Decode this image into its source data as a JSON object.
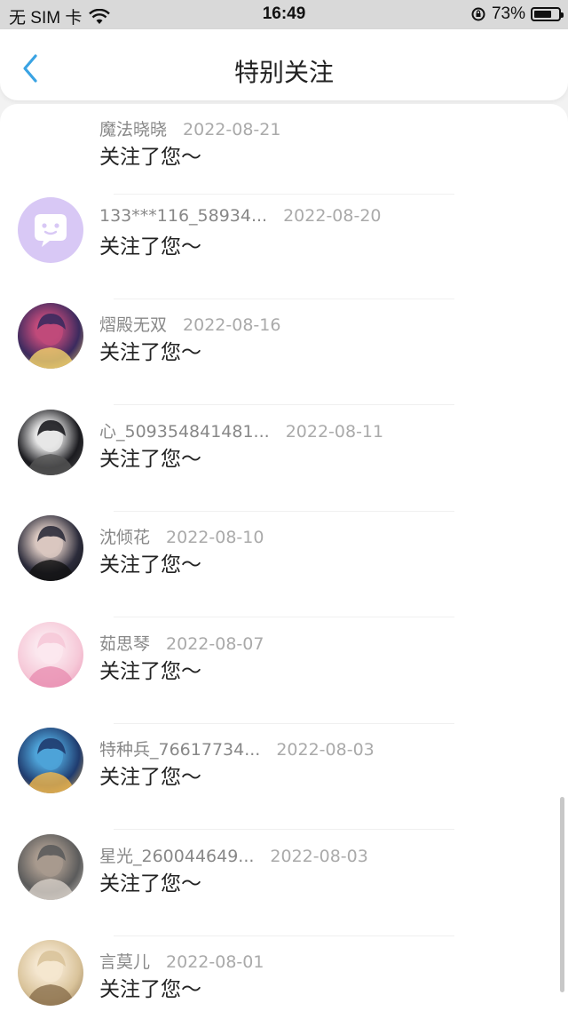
{
  "status_bar": {
    "carrier": "无 SIM 卡",
    "time": "16:49",
    "battery_pct": "73%",
    "battery_level": 0.73
  },
  "nav": {
    "title": "特别关注"
  },
  "colors": {
    "accent": "#3aa3e3",
    "bubble_avatar_bg": "#d8c8f5"
  },
  "items": [
    {
      "name": "魔法晓晓",
      "date": "2022-08-21",
      "message": "关注了您～",
      "avatar": "none"
    },
    {
      "name": "133***116_58934...",
      "date": "2022-08-20",
      "message": "关注了您～",
      "avatar": "chat-bubble"
    },
    {
      "name": "熠殿无双",
      "date": "2022-08-16",
      "message": "关注了您～",
      "avatar": "anime"
    },
    {
      "name": "心_509354841481...",
      "date": "2022-08-11",
      "message": "关注了您～",
      "avatar": "anime"
    },
    {
      "name": "沈倾花",
      "date": "2022-08-10",
      "message": "关注了您～",
      "avatar": "anime"
    },
    {
      "name": "茹思琴",
      "date": "2022-08-07",
      "message": "关注了您～",
      "avatar": "anime"
    },
    {
      "name": "特种兵_76617734...",
      "date": "2022-08-03",
      "message": "关注了您～",
      "avatar": "anime"
    },
    {
      "name": "星光_260044649...",
      "date": "2022-08-03",
      "message": "关注了您～",
      "avatar": "anime"
    },
    {
      "name": "言莫儿",
      "date": "2022-08-01",
      "message": "关注了您～",
      "avatar": "anime"
    }
  ]
}
